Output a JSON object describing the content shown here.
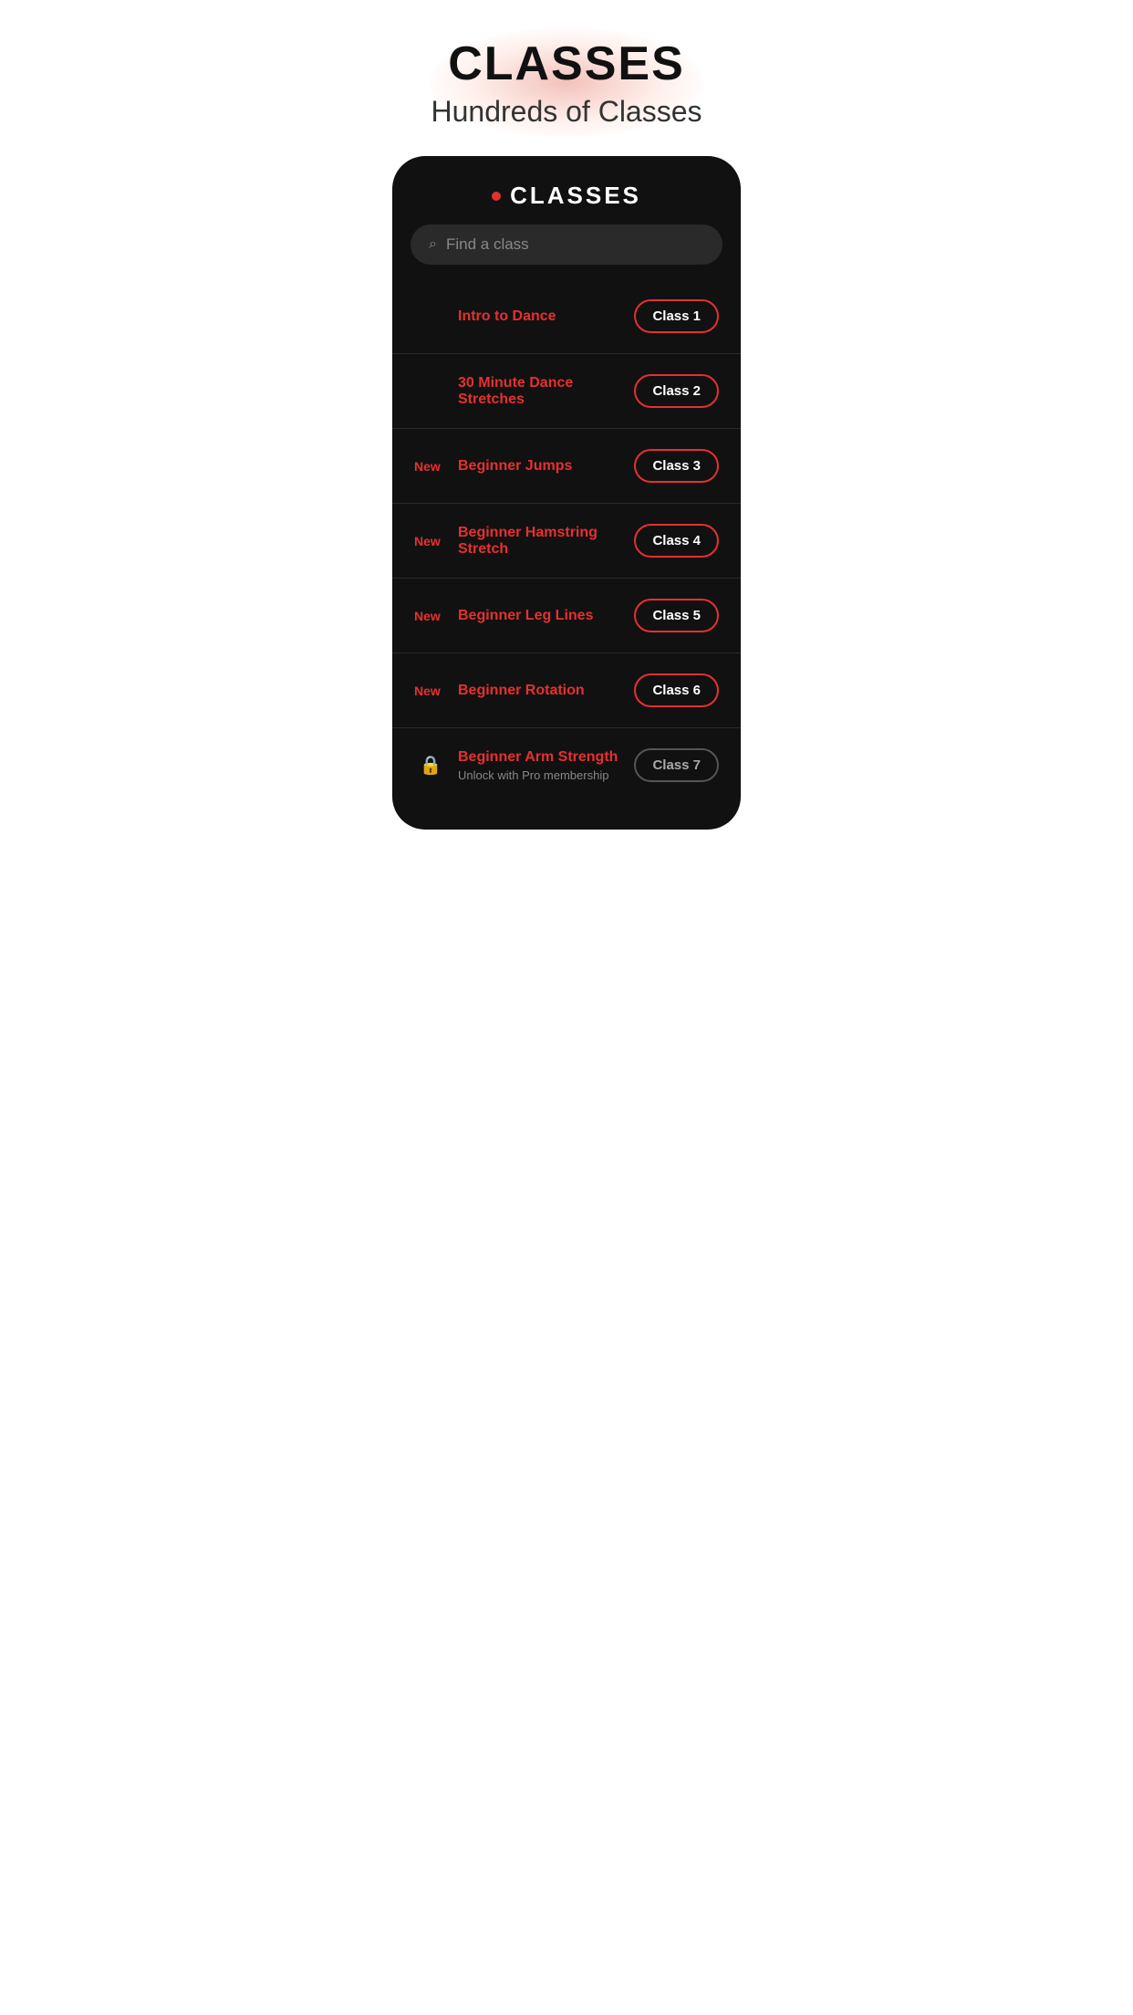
{
  "header": {
    "main_title": "CLASSES",
    "sub_title": "Hundreds of Classes"
  },
  "card": {
    "dot_color": "#e63030",
    "title": "CLASSES",
    "search": {
      "placeholder": "Find a class",
      "icon": "🔍"
    }
  },
  "classes": [
    {
      "id": 1,
      "new_badge": "",
      "name": "Intro to Dance",
      "badge_label": "Class 1",
      "locked": false,
      "lock_label": "",
      "subtitle": ""
    },
    {
      "id": 2,
      "new_badge": "",
      "name": "30 Minute Dance Stretches",
      "badge_label": "Class 2",
      "locked": false,
      "lock_label": "",
      "subtitle": ""
    },
    {
      "id": 3,
      "new_badge": "New",
      "name": "Beginner Jumps",
      "badge_label": "Class 3",
      "locked": false,
      "lock_label": "",
      "subtitle": ""
    },
    {
      "id": 4,
      "new_badge": "New",
      "name": "Beginner Hamstring Stretch",
      "badge_label": "Class 4",
      "locked": false,
      "lock_label": "",
      "subtitle": ""
    },
    {
      "id": 5,
      "new_badge": "New",
      "name": "Beginner Leg Lines",
      "badge_label": "Class 5",
      "locked": false,
      "lock_label": "",
      "subtitle": ""
    },
    {
      "id": 6,
      "new_badge": "New",
      "name": "Beginner Rotation",
      "badge_label": "Class 6",
      "locked": false,
      "lock_label": "",
      "subtitle": ""
    },
    {
      "id": 7,
      "new_badge": "",
      "name": "Beginner Arm Strength",
      "badge_label": "Class 7",
      "locked": true,
      "lock_label": "🔒",
      "subtitle": "Unlock with Pro membership"
    }
  ],
  "colors": {
    "accent": "#e63030",
    "background_dark": "#111111",
    "text_light": "#ffffff",
    "text_muted": "#888888",
    "border": "#2a2a2a"
  }
}
